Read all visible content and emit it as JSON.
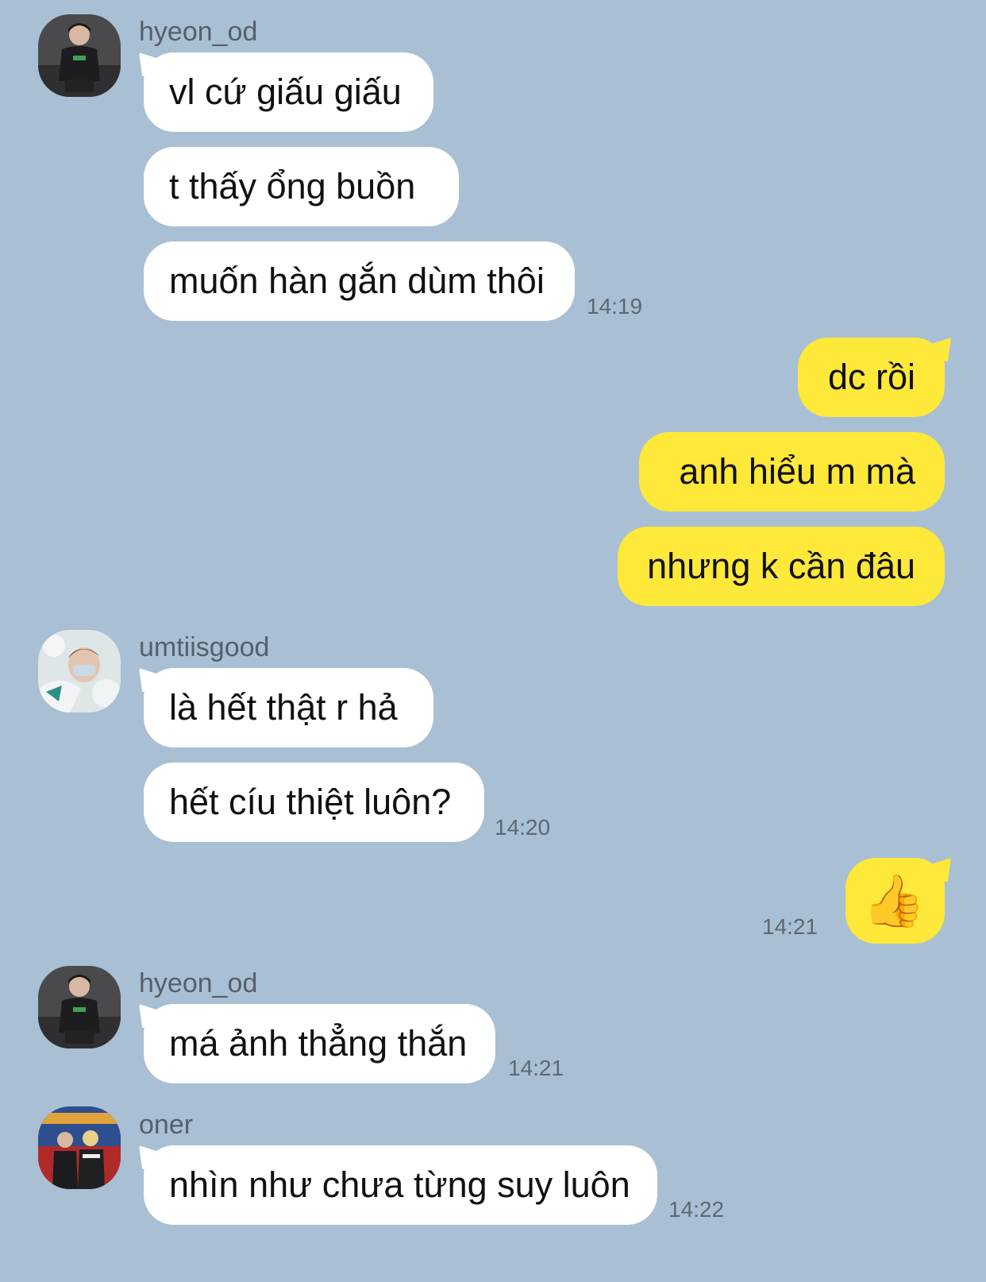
{
  "theme": {
    "background": "#a9bfd3",
    "incoming_bubble": "#ffffff",
    "outgoing_bubble": "#fee83a"
  },
  "groups": [
    {
      "sender": "hyeon_od",
      "avatar": "avatar-photo",
      "messages": [
        "vl cứ giấu giấu",
        "t thấy ổng buồn",
        "muốn hàn gắn dùm thôi"
      ],
      "time": "14:19"
    },
    {
      "sender": "me",
      "messages": [
        "dc rồi",
        "anh hiểu m mà",
        "nhưng k cần đâu"
      ]
    },
    {
      "sender": "umtiisgood",
      "avatar": "avatar-photo",
      "messages": [
        "là hết thật r hả",
        "hết cíu thiệt luôn?"
      ],
      "time": "14:20"
    },
    {
      "sender": "me",
      "messages": [
        "👍"
      ],
      "time": "14:21"
    },
    {
      "sender": "hyeon_od",
      "avatar": "avatar-photo",
      "messages": [
        "má ảnh thẳng thắn"
      ],
      "time": "14:21"
    },
    {
      "sender": "oner",
      "avatar": "avatar-photo",
      "messages": [
        "nhìn như chưa từng suy luôn"
      ],
      "time": "14:22"
    }
  ]
}
